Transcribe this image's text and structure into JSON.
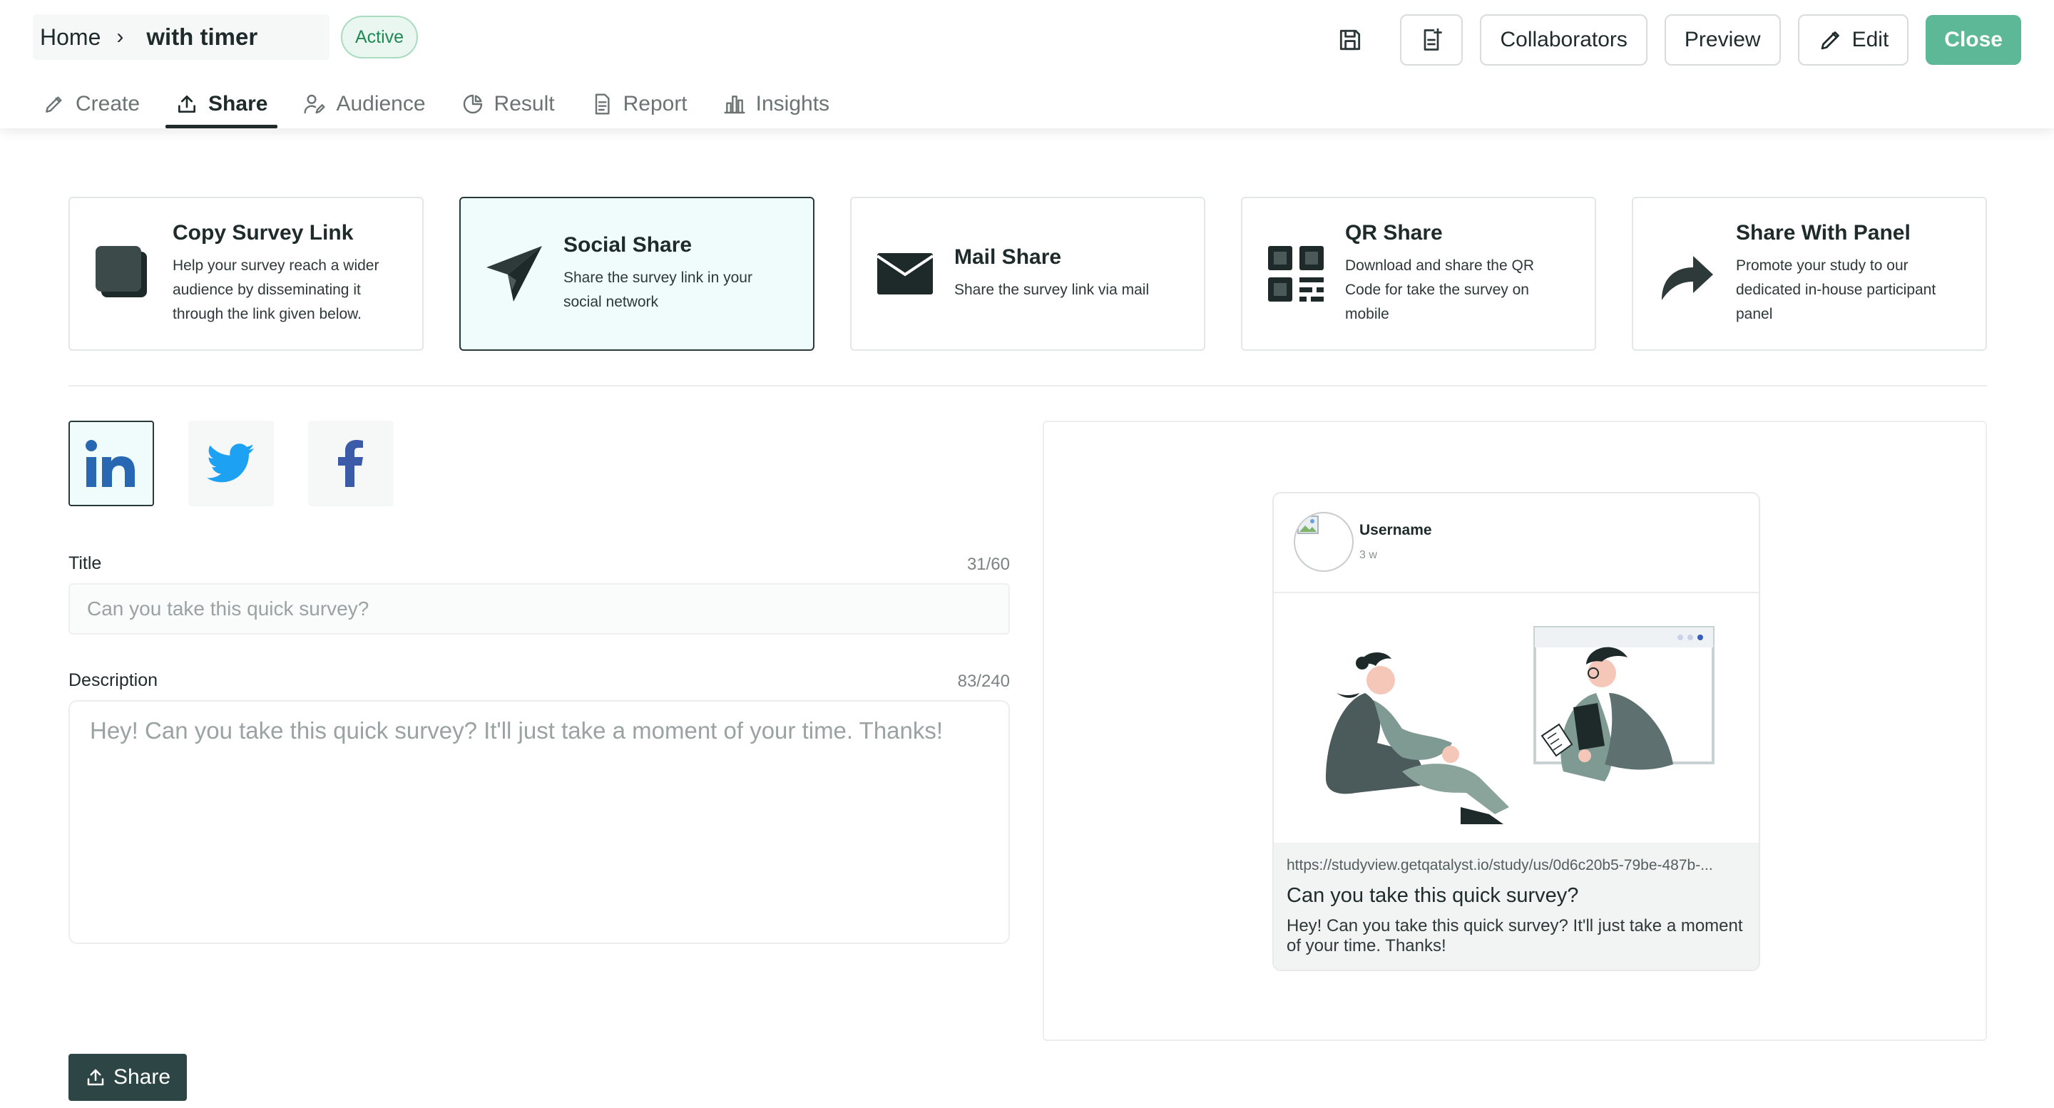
{
  "header": {
    "breadcrumb_home": "Home",
    "breadcrumb_sep": "›",
    "survey_name": "with timer",
    "status": "Active",
    "collaborators_label": "Collaborators",
    "preview_label": "Preview",
    "edit_label": "Edit",
    "close_label": "Close"
  },
  "tabs": [
    {
      "label": "Create",
      "icon": "pencil-icon"
    },
    {
      "label": "Share",
      "icon": "upload-icon",
      "active": true
    },
    {
      "label": "Audience",
      "icon": "audience-icon"
    },
    {
      "label": "Result",
      "icon": "pie-chart-icon"
    },
    {
      "label": "Report",
      "icon": "document-icon"
    },
    {
      "label": "Insights",
      "icon": "bar-chart-icon"
    }
  ],
  "share_options": [
    {
      "title": "Copy Survey Link",
      "description": "Help your survey reach a wider audience by disseminating it through the link given below.",
      "icon": "copy-icon"
    },
    {
      "title": "Social Share",
      "description": "Share the survey link in your social network",
      "icon": "paper-plane-icon",
      "selected": true
    },
    {
      "title": "Mail Share",
      "description": "Share the survey link via mail",
      "icon": "envelope-icon"
    },
    {
      "title": "QR Share",
      "description": "Download and share the QR Code for take the survey on mobile",
      "icon": "qr-code-icon"
    },
    {
      "title": "Share With Panel",
      "description": "Promote your study to our dedicated in-house participant panel",
      "icon": "share-arrow-icon"
    }
  ],
  "socials": [
    {
      "name": "linkedin",
      "icon": "linkedin-icon",
      "selected": true,
      "color": "#2867b2"
    },
    {
      "name": "twitter",
      "icon": "twitter-icon",
      "color": "#1da1f2"
    },
    {
      "name": "facebook",
      "icon": "facebook-icon",
      "color": "#3b5aa8"
    }
  ],
  "form": {
    "title_label": "Title",
    "title_counter": "31/60",
    "title_placeholder": "Can you take this quick survey?",
    "description_label": "Description",
    "description_counter": "83/240",
    "description_placeholder": "Hey! Can you take this quick survey? It'll just take a moment of your time. Thanks!",
    "share_button": "Share"
  },
  "preview": {
    "username": "Username",
    "time": "3 w",
    "url": "https://studyview.getqatalyst.io/study/us/0d6c20b5-79be-487b-...",
    "title": "Can you take this quick survey?",
    "description": "Hey! Can you take this quick survey? It'll just take a moment of your time. Thanks!"
  },
  "colors": {
    "accent": "#5cb896",
    "dark": "#2e4545",
    "status_green": "#1f8a56"
  }
}
